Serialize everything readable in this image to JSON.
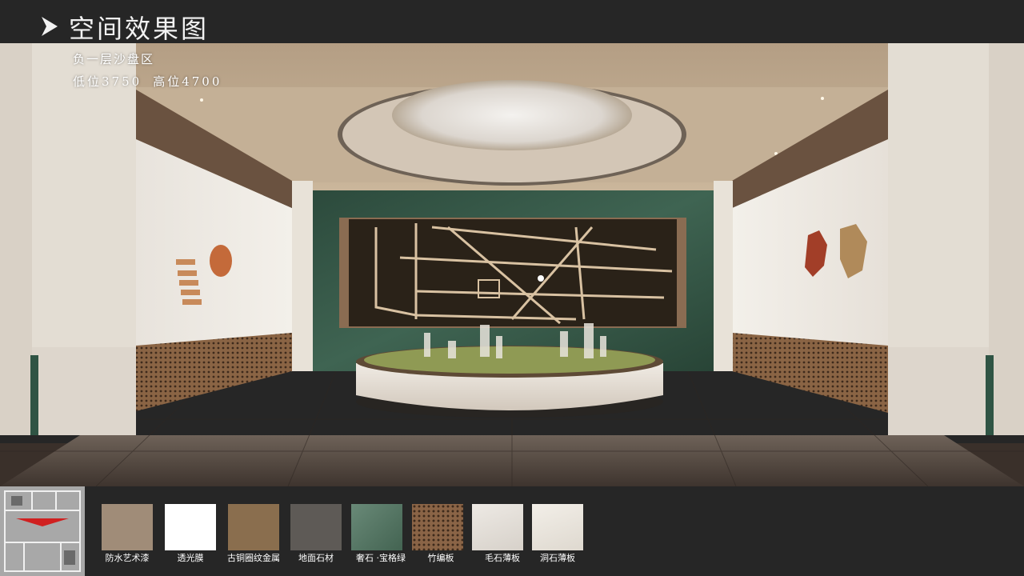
{
  "header": {
    "title": "空间效果图"
  },
  "render": {
    "area_name": "负一层沙盘区",
    "low_level": "低位3750",
    "high_level": "高位4700"
  },
  "materials": [
    {
      "label": "防水艺术漆",
      "color": "#a08c78"
    },
    {
      "label": "透光膜",
      "color": "#ffffff"
    },
    {
      "label": "古铜圈纹金属",
      "color": "#8a6e4e"
    },
    {
      "label": "地面石材",
      "color": "#5e5a56"
    },
    {
      "label": "奢石 ·宝格绿",
      "color": "#4f7560"
    },
    {
      "label": "竹编板",
      "color": "#8a6446"
    },
    {
      "label": "毛石薄板",
      "color": "#e4ded6"
    },
    {
      "label": "洞石薄板",
      "color": "#ece6dc"
    }
  ],
  "colors": {
    "background": "#262626",
    "text": "#ffffff",
    "marble_green": "#2f5444",
    "bronze": "#8a6444"
  }
}
